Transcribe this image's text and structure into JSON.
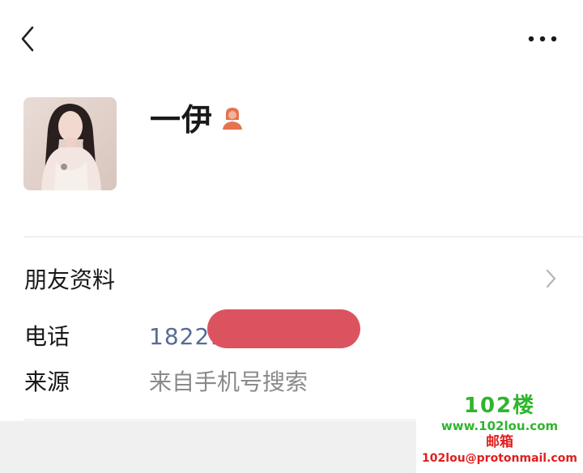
{
  "header": {
    "back_icon": "chevron-left-icon",
    "more_icon": "more-dots-icon"
  },
  "profile": {
    "name": "一伊",
    "gender_icon": "female-user-icon",
    "gender_color": "#e5734f"
  },
  "rows": {
    "friend_info_label": "朋友资料",
    "phone_label": "电话",
    "phone_value": "18221",
    "source_label": "来源",
    "source_value": "来自手机号搜索"
  },
  "watermark": {
    "logo": "102楼",
    "site": "www.102lou.com",
    "mail_label": "邮箱",
    "mail_address": "102lou@protonmail.com"
  },
  "colors": {
    "link": "#576b95",
    "redaction": "#dc5360",
    "watermark_green": "#2fb52d",
    "watermark_red": "#e11e1e"
  }
}
